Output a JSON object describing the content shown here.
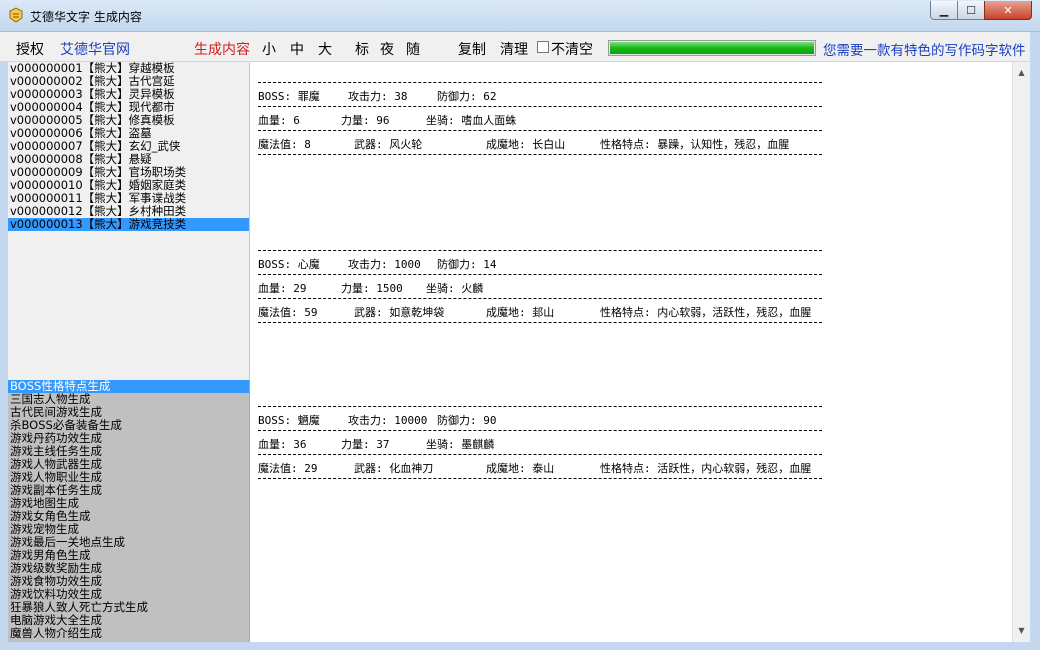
{
  "window": {
    "title": "艾德华文字 生成内容"
  },
  "toolbar": {
    "authorize": "授权",
    "official_site": "艾德华官网",
    "generate": "生成内容",
    "small": "小",
    "medium": "中",
    "large": "大",
    "standard": "标",
    "night": "夜",
    "random": "随",
    "copy": "复制",
    "clear": "清理",
    "no_clear": "不清空",
    "progress": 1.0,
    "ad_text": "您需要一款有特色的写作码字软件"
  },
  "template_list": [
    "v000000001【熊大】穿越模板",
    "v000000002【熊大】古代宫延",
    "v000000003【熊大】灵异模板",
    "v000000004【熊大】现代都市",
    "v000000005【熊大】修真模板",
    "v000000006【熊大】盗墓",
    "v000000007【熊大】玄幻_武侠",
    "v000000008【熊大】悬疑",
    "v000000009【熊大】官场职场类",
    "v000000010【熊大】婚姻家庭类",
    "v000000011【熊大】军事谍战类",
    "v000000012【熊大】乡村种田类",
    "v000000013【熊大】游戏竞技类"
  ],
  "template_selected": 12,
  "generator_list": [
    "BOSS性格特点生成",
    "三国志人物生成",
    "古代民间游戏生成",
    "杀BOSS必备装备生成",
    "游戏丹药功效生成",
    "游戏主线任务生成",
    "游戏人物武器生成",
    "游戏人物职业生成",
    "游戏副本任务生成",
    "游戏地图生成",
    "游戏女角色生成",
    "游戏宠物生成",
    "游戏最后一关地点生成",
    "游戏男角色生成",
    "游戏级数奖励生成",
    "游戏食物功效生成",
    "游戏饮料功效生成",
    "狂暴狼人致人死亡方式生成",
    "电脑游戏大全生成",
    "魔兽人物介绍生成"
  ],
  "generator_selected": 0,
  "bosses": [
    {
      "boss": "BOSS: 罪魔",
      "attack": "攻击力: 38",
      "defense": "防御力: 62",
      "hp": "血量: 6",
      "strength": "力量: 96",
      "mount": "坐骑: 嗜血人面蛛",
      "mana": "魔法值: 8",
      "weapon": "武器: 风火轮",
      "origin": "成魔地: 长白山",
      "traits": "性格特点: 暴躁，认知性，残忍，血腥"
    },
    {
      "boss": "BOSS: 心魔",
      "attack": "攻击力: 1000",
      "defense": "防御力: 14",
      "hp": "血量: 29",
      "strength": "力量: 1500",
      "mount": "坐骑: 火麟",
      "mana": "魔法值: 59",
      "weapon": "武器: 如意乾坤袋",
      "origin": "成魔地: 邽山",
      "traits": "性格特点: 内心软弱，活跃性，残忍，血腥"
    },
    {
      "boss": "BOSS: 魉魔",
      "attack": "攻击力: 10000",
      "defense": "防御力: 90",
      "hp": "血量: 36",
      "strength": "力量: 37",
      "mount": "坐骑: 墨麒麟",
      "mana": "魔法值: 29",
      "weapon": "武器: 化血神刀",
      "origin": "成魔地: 泰山",
      "traits": "性格特点: 活跃性，内心软弱，残忍，血腥"
    }
  ]
}
